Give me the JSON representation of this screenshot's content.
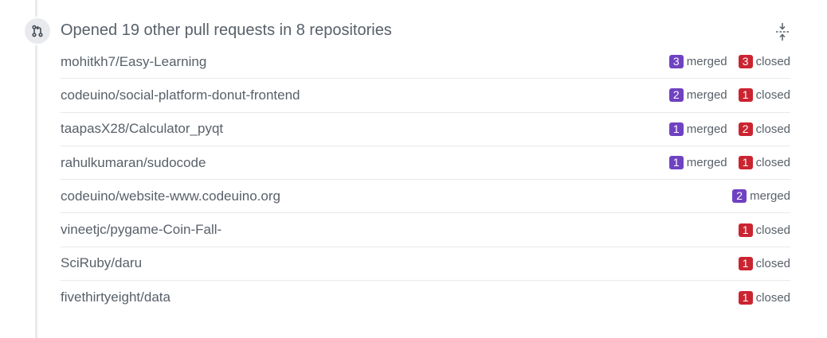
{
  "header": {
    "title": "Opened 19 other pull requests in 8 repositories"
  },
  "colors": {
    "merged": "#6f42c1",
    "closed": "#cb2431",
    "text": "#586069"
  },
  "icons": {
    "timeline": "git-pull-request-icon",
    "collapse": "fold-icon"
  },
  "repos": [
    {
      "name": "mohitkh7/Easy-Learning",
      "merged": "3",
      "merged_label": "merged",
      "closed": "3",
      "closed_label": "closed"
    },
    {
      "name": "codeuino/social-platform-donut-frontend",
      "merged": "2",
      "merged_label": "merged",
      "closed": "1",
      "closed_label": "closed"
    },
    {
      "name": "taapasX28/Calculator_pyqt",
      "merged": "1",
      "merged_label": "merged",
      "closed": "2",
      "closed_label": "closed"
    },
    {
      "name": "rahulkumaran/sudocode",
      "merged": "1",
      "merged_label": "merged",
      "closed": "1",
      "closed_label": "closed"
    },
    {
      "name": "codeuino/website-www.codeuino.org",
      "merged": "2",
      "merged_label": "merged"
    },
    {
      "name": "vineetjc/pygame-Coin-Fall-",
      "closed": "1",
      "closed_label": "closed"
    },
    {
      "name": "SciRuby/daru",
      "closed": "1",
      "closed_label": "closed"
    },
    {
      "name": "fivethirtyeight/data",
      "closed": "1",
      "closed_label": "closed"
    }
  ]
}
